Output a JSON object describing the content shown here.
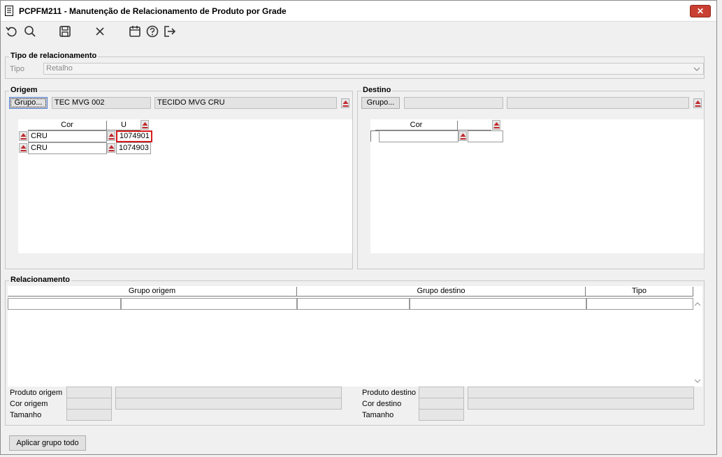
{
  "window": {
    "title": "PCPFM211 - Manutenção de Relacionamento de Produto por Grade",
    "close_label": "✕"
  },
  "toolbar": {
    "icons": [
      "undo-icon",
      "search-icon",
      "save-icon",
      "cancel-icon",
      "calendar-icon",
      "help-icon",
      "exit-icon"
    ]
  },
  "tipo_relacionamento": {
    "legend": "Tipo de relacionamento",
    "tipo_label": "Tipo",
    "tipo_value": "Retalho"
  },
  "origem": {
    "legend": "Origem",
    "grupo_button": "Grupo...",
    "grupo_code": "TEC MVG 002",
    "grupo_desc": "TECIDO MVG CRU",
    "columns": [
      "Cor",
      "U"
    ],
    "rows": [
      {
        "cor": "CRU",
        "u": "1074901"
      },
      {
        "cor": "CRU",
        "u": "1074903"
      }
    ]
  },
  "destino": {
    "legend": "Destino",
    "grupo_button": "Grupo...",
    "grupo_code": "",
    "grupo_desc": "",
    "columns": [
      "Cor",
      ""
    ]
  },
  "relacionamento": {
    "legend": "Relacionamento",
    "columns": [
      "Grupo origem",
      "Grupo destino",
      "Tipo"
    ],
    "produto_origem_label": "Produto origem",
    "cor_origem_label": "Cor origem",
    "tamanho_origem_label": "Tamanho",
    "produto_destino_label": "Produto destino",
    "cor_destino_label": "Cor destino",
    "tamanho_destino_label": "Tamanho"
  },
  "footer": {
    "aplicar_button": "Aplicar grupo todo"
  },
  "colors": {
    "selected_border": "#d51c1c",
    "close_button": "#c94033",
    "eject_icon": "#c0282d"
  }
}
